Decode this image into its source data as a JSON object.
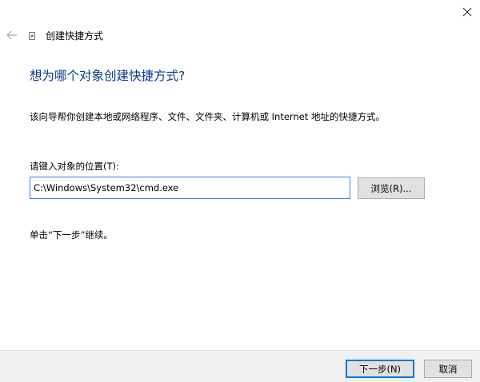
{
  "window": {
    "title": "创建快捷方式"
  },
  "title_bar": {
    "close_icon": "close-icon",
    "back_icon": "back-arrow-icon"
  },
  "content": {
    "heading": "想为哪个对象创建快捷方式?",
    "description": "该向导帮你创建本地或网络程序、文件、文件夹、计算机或 Internet 地址的快捷方式。",
    "field_label": "请键入对象的位置(T):",
    "location_value": "C:\\Windows\\System32\\cmd.exe",
    "browse_label": "浏览(R)...",
    "hint": "单击“下一步”继续。"
  },
  "footer": {
    "next_label": "下一步(N)",
    "cancel_label": "取消"
  },
  "colors": {
    "heading": "#0b3a8c",
    "input_border": "#3b7ddb",
    "default_button_border": "#0078d7",
    "footer_bg": "#f0f0f0"
  }
}
